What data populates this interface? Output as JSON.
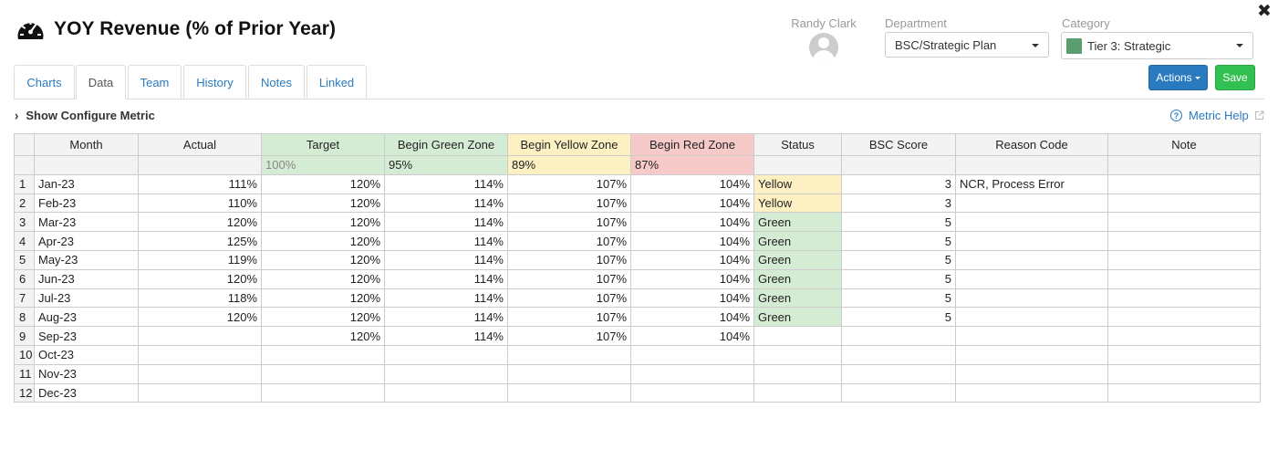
{
  "header": {
    "title": "YOY Revenue (% of Prior Year)",
    "icon": "gauge-icon"
  },
  "user": {
    "name": "Randy Clark"
  },
  "department": {
    "label": "Department",
    "value": "BSC/Strategic Plan"
  },
  "category": {
    "label": "Category",
    "value": "Tier 3: Strategic",
    "swatch_color": "#5a9e6f"
  },
  "buttons": {
    "actions": "Actions",
    "save": "Save"
  },
  "tabs": [
    {
      "label": "Charts"
    },
    {
      "label": "Data",
      "active": true
    },
    {
      "label": "Team"
    },
    {
      "label": "History"
    },
    {
      "label": "Notes"
    },
    {
      "label": "Linked"
    }
  ],
  "config": {
    "label": "Show Configure Metric"
  },
  "help": {
    "label": "Metric Help"
  },
  "grid": {
    "columns": [
      "Month",
      "Actual",
      "Target",
      "Begin Green Zone",
      "Begin Yellow Zone",
      "Begin Red Zone",
      "Status",
      "BSC Score",
      "Reason Code",
      "Note"
    ],
    "zone_row": {
      "target": "100%",
      "green": "95%",
      "yellow": "89%",
      "red": "87%"
    },
    "rows": [
      {
        "n": "1",
        "month": "Jan-23",
        "actual": "111%",
        "target": "120%",
        "green": "114%",
        "yellow": "107%",
        "red": "104%",
        "status": "Yellow",
        "score": "3",
        "reason": "NCR, Process Error",
        "note": ""
      },
      {
        "n": "2",
        "month": "Feb-23",
        "actual": "110%",
        "target": "120%",
        "green": "114%",
        "yellow": "107%",
        "red": "104%",
        "status": "Yellow",
        "score": "3",
        "reason": "",
        "note": ""
      },
      {
        "n": "3",
        "month": "Mar-23",
        "actual": "120%",
        "target": "120%",
        "green": "114%",
        "yellow": "107%",
        "red": "104%",
        "status": "Green",
        "score": "5",
        "reason": "",
        "note": ""
      },
      {
        "n": "4",
        "month": "Apr-23",
        "actual": "125%",
        "target": "120%",
        "green": "114%",
        "yellow": "107%",
        "red": "104%",
        "status": "Green",
        "score": "5",
        "reason": "",
        "note": ""
      },
      {
        "n": "5",
        "month": "May-23",
        "actual": "119%",
        "target": "120%",
        "green": "114%",
        "yellow": "107%",
        "red": "104%",
        "status": "Green",
        "score": "5",
        "reason": "",
        "note": ""
      },
      {
        "n": "6",
        "month": "Jun-23",
        "actual": "120%",
        "target": "120%",
        "green": "114%",
        "yellow": "107%",
        "red": "104%",
        "status": "Green",
        "score": "5",
        "reason": "",
        "note": ""
      },
      {
        "n": "7",
        "month": "Jul-23",
        "actual": "118%",
        "target": "120%",
        "green": "114%",
        "yellow": "107%",
        "red": "104%",
        "status": "Green",
        "score": "5",
        "reason": "",
        "note": ""
      },
      {
        "n": "8",
        "month": "Aug-23",
        "actual": "120%",
        "target": "120%",
        "green": "114%",
        "yellow": "107%",
        "red": "104%",
        "status": "Green",
        "score": "5",
        "reason": "",
        "note": ""
      },
      {
        "n": "9",
        "month": "Sep-23",
        "actual": "",
        "target": "120%",
        "green": "114%",
        "yellow": "107%",
        "red": "104%",
        "status": "",
        "score": "",
        "reason": "",
        "note": ""
      },
      {
        "n": "10",
        "month": "Oct-23",
        "actual": "",
        "target": "",
        "green": "",
        "yellow": "",
        "red": "",
        "status": "",
        "score": "",
        "reason": "",
        "note": ""
      },
      {
        "n": "11",
        "month": "Nov-23",
        "actual": "",
        "target": "",
        "green": "",
        "yellow": "",
        "red": "",
        "status": "",
        "score": "",
        "reason": "",
        "note": ""
      },
      {
        "n": "12",
        "month": "Dec-23",
        "actual": "",
        "target": "",
        "green": "",
        "yellow": "",
        "red": "",
        "status": "",
        "score": "",
        "reason": "",
        "note": ""
      }
    ]
  },
  "colors": {
    "green_zone": "#d4ecd4",
    "yellow_zone": "#fdf1c4",
    "red_zone": "#f7caca",
    "link": "#2a7ac0",
    "save": "#33c052",
    "actions": "#2a7ac0"
  }
}
